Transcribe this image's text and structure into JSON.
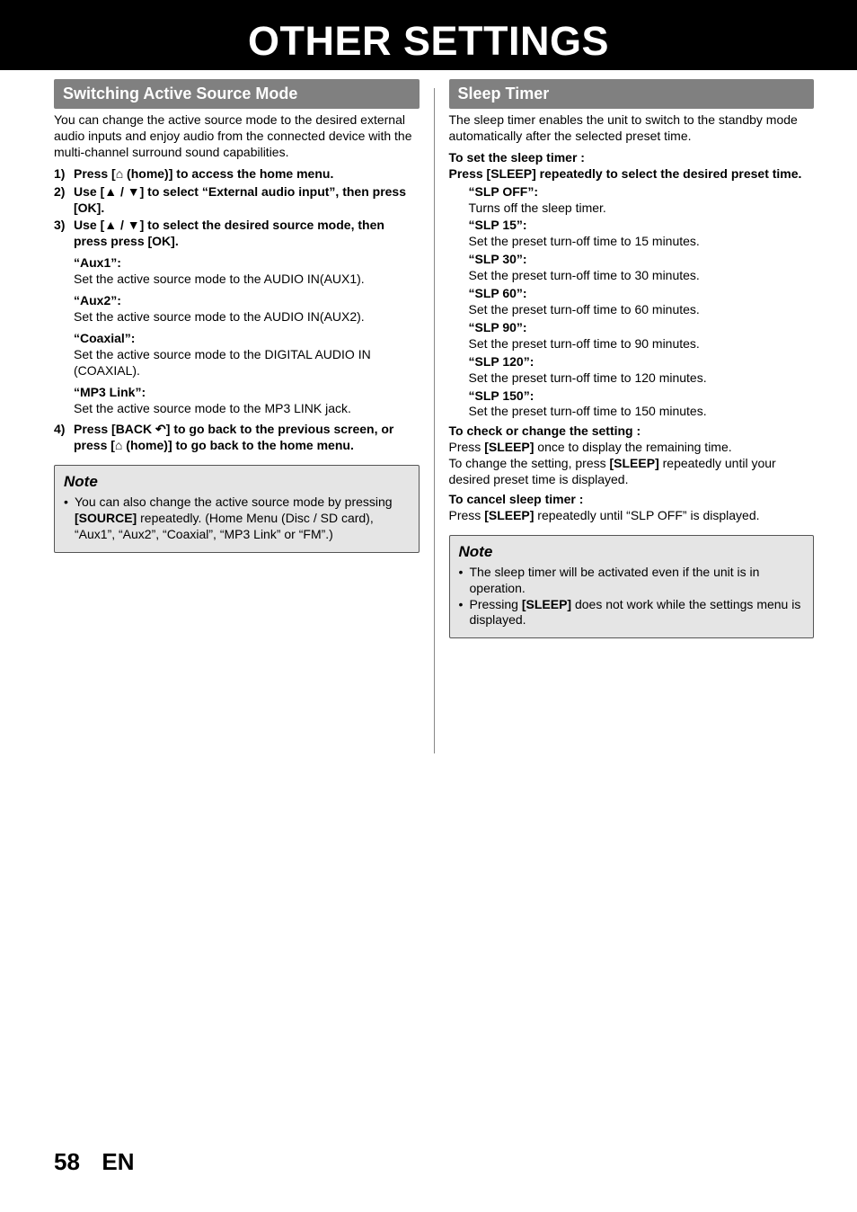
{
  "chapterTitle": "OTHER SETTINGS",
  "left": {
    "header": "Switching Active Source Mode",
    "intro": "You can change the active source mode to the desired external audio inputs and enjoy audio from the connected device with the multi-channel surround sound capabilities.",
    "step1": "Press [▲ (home)] to access the home menu.",
    "step1_display": "Press [⌂ (home)] to access the home menu.",
    "step2": "Use [▲ / ▼] to select “External audio input”, then press [OK].",
    "step3": "Use [▲ / ▼] to select the desired source mode, then press press [OK].",
    "options": [
      {
        "label": "“Aux1”:",
        "desc": "Set the active source mode to the AUDIO IN(AUX1)."
      },
      {
        "label": "“Aux2”:",
        "desc": "Set the active source mode to the AUDIO IN(AUX2)."
      },
      {
        "label": "“Coaxial”:",
        "desc": "Set the active source mode to the DIGITAL AUDIO IN (COAXIAL)."
      },
      {
        "label": "“MP3 Link”:",
        "desc": "Set the active source mode to the MP3 LINK jack."
      }
    ],
    "step4": "Press [BACK ↺] to go back to the previous screen, or press [⌂ (home)] to go back to the home menu.",
    "noteTitle": "Note",
    "note_prefix": "You can also change the active source mode by pressing ",
    "note_bold": "[SOURCE]",
    "note_suffix": " repeatedly. (Home Menu (Disc / SD card), “Aux1”, “Aux2”, “Coaxial”, “MP3 Link” or “FM”.)"
  },
  "right": {
    "header": "Sleep Timer",
    "intro": "The sleep timer enables the unit to switch to the standby mode automatically after the selected preset time.",
    "set_title": "To set the sleep timer :",
    "set_instruction": "Press [SLEEP] repeatedly to select the desired preset time.",
    "options": [
      {
        "label": "“SLP OFF”:",
        "desc": "Turns off the sleep timer."
      },
      {
        "label": "“SLP 15”:",
        "desc": "Set the preset turn-off time to 15 minutes."
      },
      {
        "label": "“SLP 30”:",
        "desc": "Set the preset turn-off time to 30 minutes."
      },
      {
        "label": "“SLP 60”:",
        "desc": "Set the preset turn-off time to 60 minutes."
      },
      {
        "label": "“SLP 90”:",
        "desc": "Set the preset turn-off time to 90 minutes."
      },
      {
        "label": "“SLP 120”:",
        "desc": "Set the preset turn-off time to 120 minutes."
      },
      {
        "label": "“SLP 150”:",
        "desc": "Set the preset turn-off time to 150 minutes."
      }
    ],
    "check_title": "To check or change the setting :",
    "check_p1a": "Press ",
    "check_p1b": "[SLEEP]",
    "check_p1c": " once to display the remaining time.",
    "check_p2a": "To change the setting, press ",
    "check_p2b": "[SLEEP]",
    "check_p2c": " repeatedly until your desired preset time is displayed.",
    "cancel_title": "To cancel sleep timer :",
    "cancel_a": "Press ",
    "cancel_b": "[SLEEP]",
    "cancel_c": " repeatedly until “SLP OFF” is displayed.",
    "noteTitle": "Note",
    "note1": "The sleep timer will be activated even if the unit is in operation.",
    "note2a": "Pressing ",
    "note2b": "[SLEEP]",
    "note2c": " does not work while the settings menu is displayed."
  },
  "footer": {
    "page": "58",
    "lang": "EN"
  }
}
